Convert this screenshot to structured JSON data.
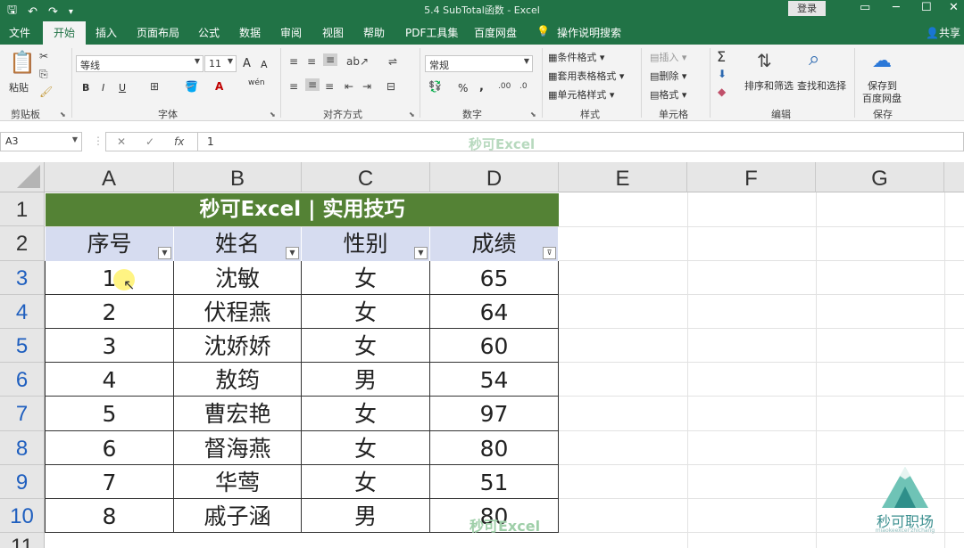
{
  "window": {
    "title": "5.4 SubTotal函数 - Excel",
    "login_label": "登录",
    "minimize": "─",
    "maximize": "☐",
    "close": "✕",
    "qa_save": "🖫",
    "qa_undo": "↶",
    "qa_redo": "↷",
    "qa_more": "▾"
  },
  "tabs": [
    {
      "label": "文件"
    },
    {
      "label": "开始"
    },
    {
      "label": "插入"
    },
    {
      "label": "页面布局"
    },
    {
      "label": "公式"
    },
    {
      "label": "数据"
    },
    {
      "label": "审阅"
    },
    {
      "label": "视图"
    },
    {
      "label": "帮助"
    },
    {
      "label": "PDF工具集"
    },
    {
      "label": "百度网盘"
    },
    {
      "label": "操作说明搜索"
    }
  ],
  "share_label": "共享",
  "ribbon": {
    "clipboard": {
      "paste": "粘贴",
      "label": "剪贴板"
    },
    "font": {
      "name": "等线",
      "size": "11",
      "label": "字体",
      "bold": "B",
      "italic": "I",
      "underline": "U",
      "grow": "A",
      "shrink": "A",
      "wen": "wén"
    },
    "align": {
      "label": "对齐方式"
    },
    "number": {
      "format": "常规",
      "label": "数字",
      "percent": "%",
      "comma": ","
    },
    "styles": {
      "cond": "条件格式",
      "table": "套用表格格式",
      "cell": "单元格样式",
      "label": "样式"
    },
    "cells": {
      "insert": "插入",
      "delete": "删除",
      "format": "格式",
      "label": "单元格"
    },
    "editing": {
      "sum": "Σ",
      "sort": "排序和筛选",
      "find": "查找和选择",
      "label": "编辑"
    },
    "save": {
      "line1": "保存到",
      "line2": "百度网盘",
      "label": "保存"
    }
  },
  "formula_bar": {
    "name_box": "A3",
    "cancel": "✕",
    "enter": "✓",
    "fx": "fx",
    "value": "1",
    "watermark": "秒可Excel"
  },
  "sheet": {
    "columns": [
      "A",
      "B",
      "C",
      "D",
      "E",
      "F",
      "G"
    ],
    "rows": [
      "1",
      "2",
      "3",
      "4",
      "5",
      "6",
      "7",
      "8",
      "9",
      "10",
      "11"
    ],
    "title": "秒可Excel | 实用技巧",
    "headers": [
      "序号",
      "姓名",
      "性别",
      "成绩"
    ],
    "data": [
      [
        "1",
        "沈敏",
        "女",
        "65"
      ],
      [
        "2",
        "伏程燕",
        "女",
        "64"
      ],
      [
        "3",
        "沈娇娇",
        "女",
        "60"
      ],
      [
        "4",
        "敖筠",
        "男",
        "54"
      ],
      [
        "5",
        "曹宏艳",
        "女",
        "97"
      ],
      [
        "6",
        "督海燕",
        "女",
        "80"
      ],
      [
        "7",
        "华莺",
        "女",
        "51"
      ],
      [
        "8",
        "戚子涵",
        "男",
        "80"
      ]
    ],
    "cell_watermark": "秒可Excel"
  },
  "logo": {
    "text": "秒可职场",
    "sub": "miaokeexcel·zhichang"
  },
  "colors": {
    "excel_green": "#217346",
    "title_fill": "#548235",
    "header_fill": "#d6dcf0"
  }
}
